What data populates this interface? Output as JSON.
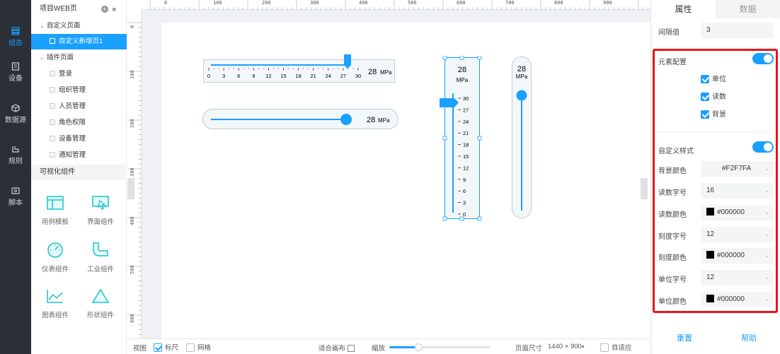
{
  "nav": {
    "items": [
      {
        "label": "组态",
        "icon": "layers-icon",
        "active": true
      },
      {
        "label": "设备",
        "icon": "device-icon"
      },
      {
        "label": "数据源",
        "icon": "cube-icon"
      },
      {
        "label": "规则",
        "icon": "rule-icon"
      },
      {
        "label": "脚本",
        "icon": "script-icon"
      }
    ]
  },
  "tree": {
    "header": "项目WEB页",
    "custom_group": "自定义页面",
    "selected_page": "自定义新增页1",
    "plugin_group": "插件页面",
    "plugin_pages": [
      "登录",
      "组织管理",
      "人员管理",
      "角色权限",
      "设备管理",
      "通知管理"
    ],
    "section_title": "可视化组件",
    "components": [
      "用例模板",
      "界面组件",
      "仪表组件",
      "工业组件",
      "图表组件",
      "形状组件"
    ]
  },
  "rulers": {
    "h_labels": [
      "0",
      "100",
      "200",
      "300",
      "400",
      "500",
      "600",
      "700",
      "800",
      "900"
    ],
    "v_labels": [
      "0",
      "100",
      "200",
      "300",
      "400",
      "500",
      "600"
    ]
  },
  "widgets": {
    "value": "28",
    "unit": "MPa",
    "h_scale": [
      "0",
      "3",
      "6",
      "9",
      "12",
      "15",
      "18",
      "21",
      "24",
      "27",
      "30"
    ],
    "v_scale": [
      "30",
      "27",
      "24",
      "21",
      "18",
      "15",
      "12",
      "9",
      "6",
      "3",
      "0"
    ],
    "h_slider_fill_fraction": 0.93,
    "v_slider_fill_fraction": 0.93
  },
  "statusbar": {
    "view_label": "视图",
    "ruler_label": "标尺",
    "grid_label": "网格",
    "fit_label": "适合画布",
    "zoom_label": "缩放",
    "page_size_label": "页面尺寸",
    "page_size_value": "1440 × 900",
    "adaptive_label": "自适应"
  },
  "panel": {
    "tabs": [
      "属性",
      "数据"
    ],
    "interval_label": "间隔值",
    "interval_value": "3",
    "element_config_label": "元素配置",
    "checks": [
      "单位",
      "读数",
      "背景"
    ],
    "custom_style_label": "自定义样式",
    "rows": [
      {
        "label": "背景颜色",
        "value": "#F2F7FA",
        "swatch": false
      },
      {
        "label": "读数字号",
        "value": "16",
        "swatch": false
      },
      {
        "label": "读数颜色",
        "value": "#000000",
        "swatch": true
      },
      {
        "label": "刻度字号",
        "value": "12",
        "swatch": false
      },
      {
        "label": "刻度颜色",
        "value": "#000000",
        "swatch": true
      },
      {
        "label": "单位字号",
        "value": "12",
        "swatch": false
      },
      {
        "label": "单位颜色",
        "value": "#000000",
        "swatch": true
      }
    ],
    "reset_label": "重置",
    "help_label": "帮助"
  },
  "colors": {
    "accent": "#1aa0ff",
    "sidebar_bg": "#2c2f36",
    "highlight_box": "#e8141a",
    "widget_bg": "#F2F7FA"
  }
}
